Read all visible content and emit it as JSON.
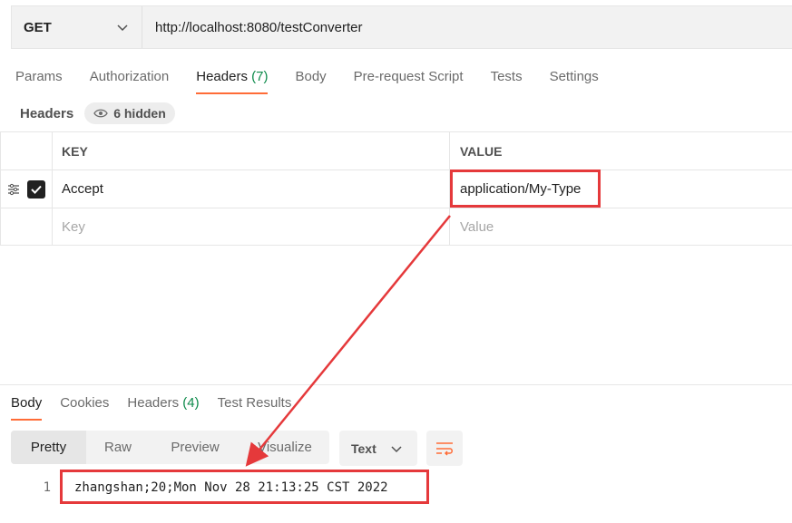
{
  "request": {
    "method": "GET",
    "url": "http://localhost:8080/testConverter"
  },
  "request_tabs": [
    {
      "label": "Params",
      "count": ""
    },
    {
      "label": "Authorization",
      "count": ""
    },
    {
      "label": "Headers",
      "count": "(7)"
    },
    {
      "label": "Body",
      "count": ""
    },
    {
      "label": "Pre-request Script",
      "count": ""
    },
    {
      "label": "Tests",
      "count": ""
    },
    {
      "label": "Settings",
      "count": ""
    }
  ],
  "headers_section": {
    "label": "Headers",
    "hidden_badge": "6 hidden"
  },
  "table": {
    "key_header": "KEY",
    "value_header": "VALUE",
    "rows": [
      {
        "key": "Accept",
        "value": "application/My-Type",
        "checked": true
      }
    ],
    "key_placeholder": "Key",
    "value_placeholder": "Value"
  },
  "response_tabs": [
    {
      "label": "Body",
      "count": ""
    },
    {
      "label": "Cookies",
      "count": ""
    },
    {
      "label": "Headers",
      "count": "(4)"
    },
    {
      "label": "Test Results",
      "count": ""
    }
  ],
  "view_modes": [
    "Pretty",
    "Raw",
    "Preview",
    "Visualize"
  ],
  "format": "Text",
  "response_body": {
    "line_number": "1",
    "text": "zhangshan;20;Mon Nov 28 21:13:25 CST 2022"
  },
  "colors": {
    "accent": "#ff6c37",
    "count_green": "#0c8a4a",
    "annotation_red": "#e5393b"
  }
}
